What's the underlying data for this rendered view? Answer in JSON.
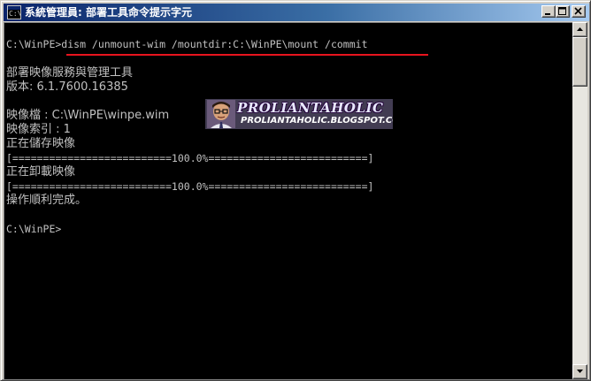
{
  "window": {
    "title": "系統管理員: 部署工具命令提示字元",
    "icon": "cmd-icon",
    "icon_glyph": "C:\\"
  },
  "console": {
    "lines": [
      "C:\\WinPE>dism /unmount-wim /mountdir:C:\\WinPE\\mount /commit",
      "部署映像服務與管理工具",
      "版本: 6.1.7600.16385",
      "映像檔 : C:\\WinPE\\winpe.wim",
      "映像索引 : 1",
      "正在儲存映像",
      "[==========================100.0%==========================]",
      "正在卸載映像",
      "[==========================100.0%==========================]",
      "操作順利完成。",
      "C:\\WinPE>"
    ]
  },
  "watermark": {
    "title": "PROLIANTAHOLIC",
    "subtitle": "PROLIANTAHOLIC.BLOGSPOT.COM"
  },
  "colors": {
    "console_bg": "#000000",
    "console_text": "#c0c0c0",
    "titlebar_start": "#0a246a",
    "titlebar_end": "#a6caf0",
    "underline": "#e8141e"
  }
}
